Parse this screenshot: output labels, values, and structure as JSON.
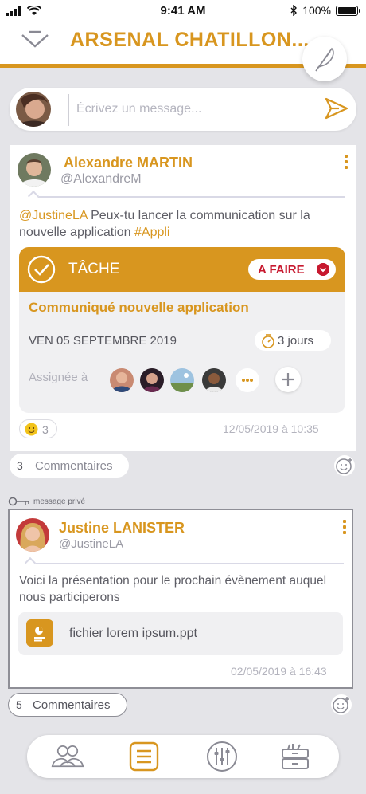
{
  "status_bar": {
    "time": "9:41 AM",
    "battery": "100%",
    "icons": [
      "signal-icon",
      "wifi-icon",
      "bluetooth-icon",
      "battery-icon"
    ]
  },
  "header": {
    "title": "ARSENAL CHATILLON...",
    "icons": [
      "chevron-down-icon",
      "feather-icon"
    ]
  },
  "composer": {
    "placeholder": "Écrivez un message..."
  },
  "posts": [
    {
      "author": "Alexandre MARTIN",
      "handle": "@AlexandreM",
      "text_mention": "@JustineLA",
      "text_body": " Peux-tu lancer la communication sur la nouvelle application ",
      "text_hashtag": "#Appli",
      "task": {
        "label": "TÂCHE",
        "status": "A FAIRE",
        "title": "Communiqué nouvelle application",
        "date": "VEN 05 SEPTEMBRE 2019",
        "duration": "3 jours",
        "assigned_label": "Assignée à",
        "assignee_count_visible": 4
      },
      "reactions": {
        "emoji": "smiley",
        "count": "3"
      },
      "timestamp": "12/05/2019 à 10:35",
      "comments": {
        "count": "3",
        "label": "Commentaires"
      }
    },
    {
      "private_label": "message privé",
      "author": "Justine LANISTER",
      "handle": "@JustineLA",
      "text": "Voici la présentation pour le prochain évènement auquel nous participerons",
      "file": {
        "name": "fichier lorem ipsum.ppt",
        "icon": "presentation-file-icon"
      },
      "timestamp": "02/05/2019 à 16:43",
      "comments": {
        "count": "5",
        "label": "Commentaires"
      }
    }
  ],
  "bottom_nav": {
    "items": [
      "community-icon",
      "feed-icon",
      "settings-sliders-icon",
      "archive-icon"
    ],
    "active": "feed-icon"
  },
  "colors": {
    "accent": "#d8961f",
    "status_red": "#c7192f",
    "background": "#e4e4e8"
  }
}
